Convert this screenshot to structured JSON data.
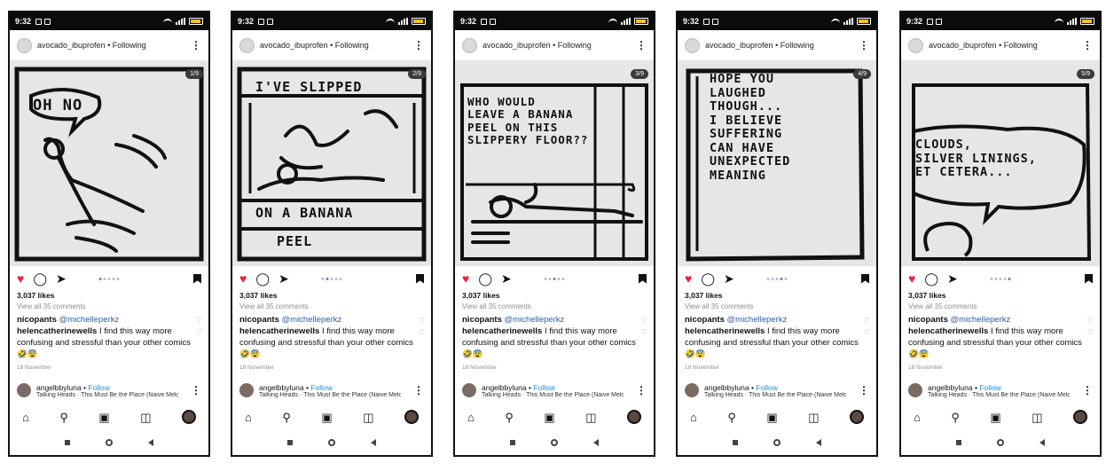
{
  "status_time": "9:32",
  "account": "avocado_ibuprofen",
  "following": "Following",
  "likes": "3,037 likes",
  "view_all": "View all 35 comments",
  "comments": [
    {
      "user": "nicopants",
      "mention": "@michelleperkz",
      "text": ""
    },
    {
      "user": "helencatherinewells",
      "mention": "",
      "text": "I find this way more confusing and stressful than your other comics 🤣😨"
    }
  ],
  "date": "18 November",
  "music": {
    "user": "angelbbyluna",
    "follow": "Follow",
    "song": "Talking Heads · This Must Be the Place (Naive Melod..."
  },
  "colors": {
    "heart": "#e8263a",
    "follow": "#1a8ee8",
    "dot_active": "#2f8fe8",
    "mention": "#2b5fa8"
  },
  "icons": {
    "like": "heart-icon",
    "comment": "comment-icon",
    "share": "send-icon",
    "save": "bookmark-icon",
    "home": "home-icon",
    "search": "search-icon",
    "reels": "reels-icon",
    "shop": "shop-icon"
  },
  "panels": [
    {
      "counter": "1/9",
      "caption": "OH NO"
    },
    {
      "counter": "2/9",
      "caption": "I'VE SLIPPED",
      "caption2": "ON A BANANA",
      "caption3": "PEEL"
    },
    {
      "counter": "3/9",
      "caption": "WHO WOULD\nLEAVE A BANANA\nPEEL ON THIS\nSLIPPERY FLOOR??"
    },
    {
      "counter": "4/9",
      "caption": "HOPE YOU\nLAUGHED\nTHOUGH...\nI BELIEVE\nSUFFERING\nCAN HAVE\nUNEXPECTED\nMEANING"
    },
    {
      "counter": "5/9",
      "caption": "CLOUDS,\nSILVER LININGS,\nET CETERA..."
    }
  ]
}
